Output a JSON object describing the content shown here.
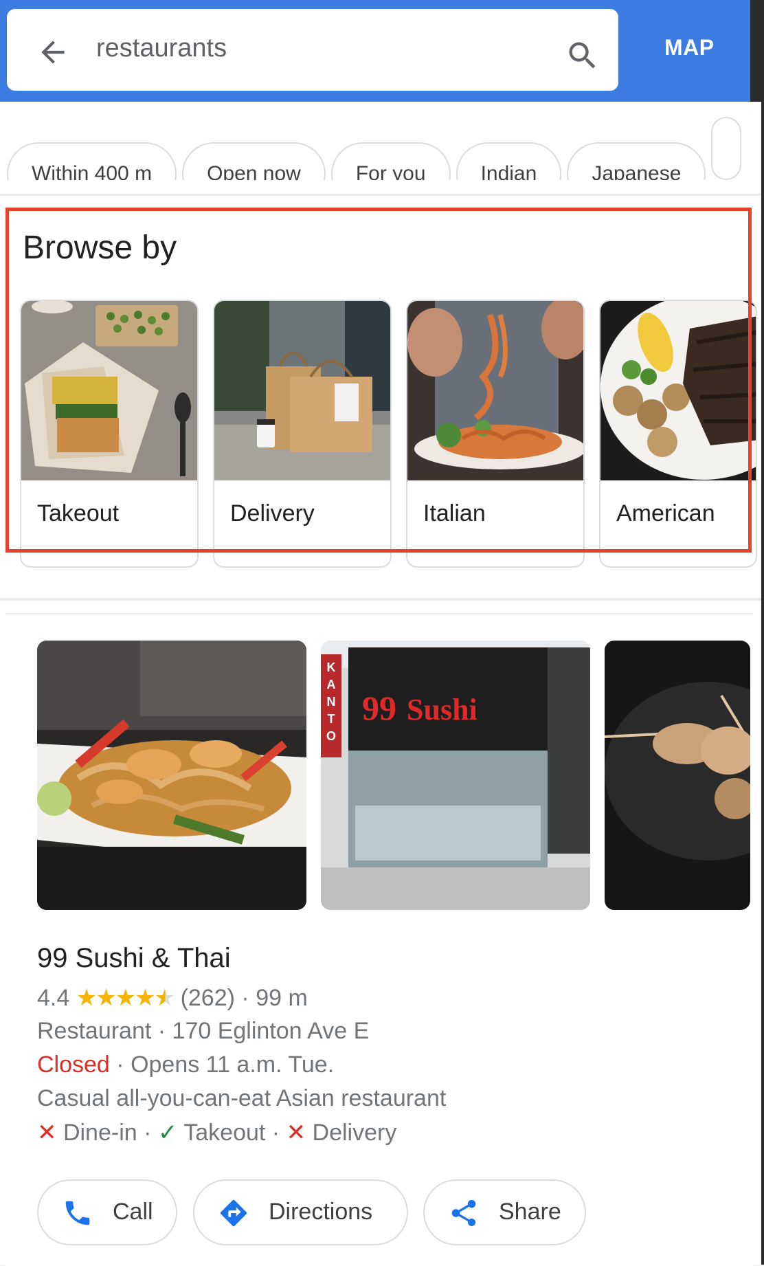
{
  "header": {
    "search_value": "restaurants",
    "map_label": "MAP",
    "colors": {
      "bar": "#3c7be0"
    }
  },
  "chips": [
    "Within 400 m",
    "Open now",
    "For you",
    "Indian",
    "Japanese"
  ],
  "browse": {
    "title": "Browse by",
    "categories": [
      {
        "label": "Takeout"
      },
      {
        "label": "Delivery"
      },
      {
        "label": "Italian"
      },
      {
        "label": "American"
      }
    ]
  },
  "result": {
    "name": "99 Sushi & Thai",
    "rating": "4.4",
    "stars": "★★★★",
    "half_star": "★",
    "reviews": "(262)",
    "distance": "99 m",
    "category": "Restaurant",
    "address": "170 Eglinton Ave E",
    "status": "Closed",
    "hours": "Opens 11 a.m. Tue.",
    "description": "Casual all-you-can-eat Asian restaurant",
    "services": [
      {
        "label": "Dine-in",
        "available": false
      },
      {
        "label": "Takeout",
        "available": true
      },
      {
        "label": "Delivery",
        "available": false
      }
    ],
    "photo_texts": {
      "sign_left": "KANTO",
      "sign_main": "99 Sushi"
    },
    "actions": {
      "call": "Call",
      "directions": "Directions",
      "share": "Share"
    }
  }
}
